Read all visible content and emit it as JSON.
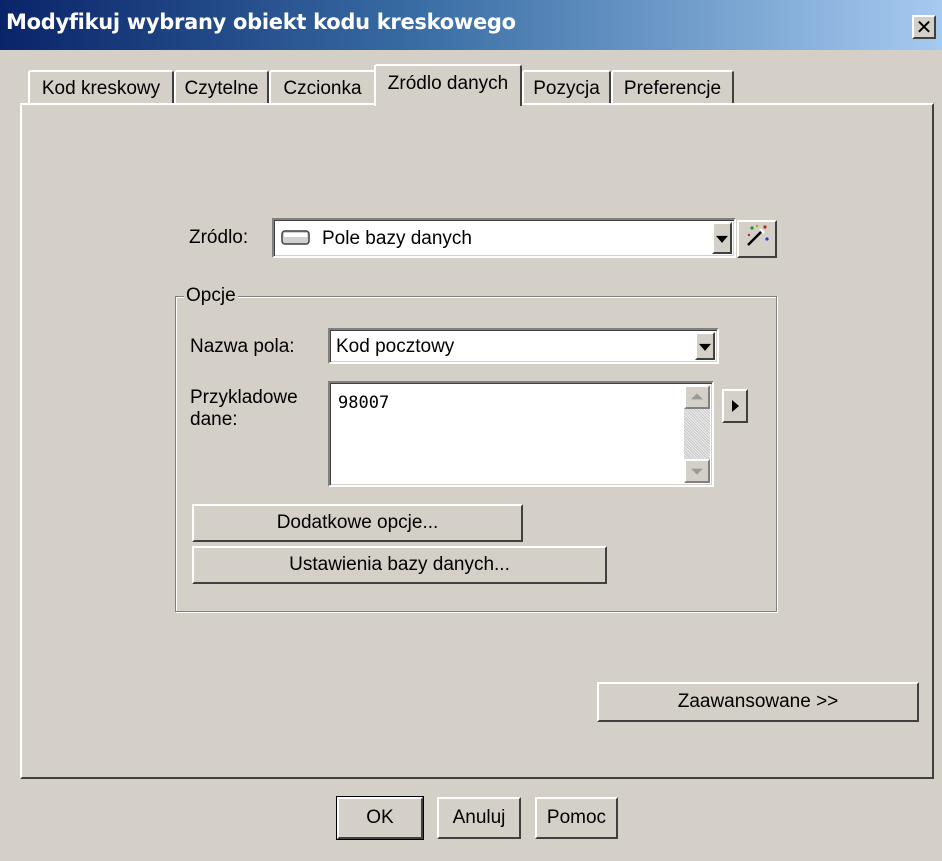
{
  "window": {
    "title": "Modyfikuj wybrany obiekt kodu kreskowego",
    "close_glyph": "✕"
  },
  "tabs": [
    {
      "label": "Kod kreskowy"
    },
    {
      "label": "Czytelne"
    },
    {
      "label": "Czcionka"
    },
    {
      "label": "Zródlo danych",
      "active": true
    },
    {
      "label": "Pozycja"
    },
    {
      "label": "Preferencje"
    }
  ],
  "source": {
    "label": "Zródlo:",
    "value": "Pole bazy danych",
    "icon": "database-field-icon",
    "wizard_icon": "magic-wand-icon"
  },
  "options": {
    "group_label": "Opcje",
    "field_name_label": "Nazwa pola:",
    "field_name_value": "Kod pocztowy",
    "sample_label": "Przykladowe dane:",
    "sample_value": "98007",
    "more_options_button": "Dodatkowe opcje...",
    "db_settings_button": "Ustawienia bazy danych..."
  },
  "advanced_button": "Zaawansowane >>",
  "footer": {
    "ok": "OK",
    "cancel": "Anuluj",
    "help": "Pomoc"
  }
}
